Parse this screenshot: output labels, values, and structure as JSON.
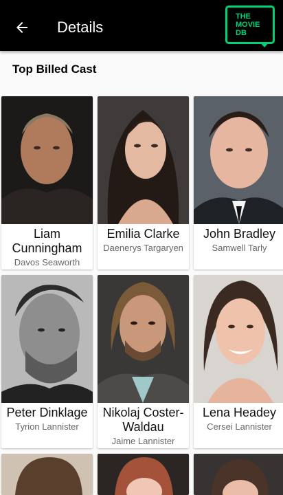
{
  "appbar": {
    "title": "Details",
    "logo_text": "THE\nMOVIE\nDB",
    "back_icon": "arrow-left-icon",
    "brand_color": "#01d277"
  },
  "section": {
    "title": "Top Billed Cast"
  },
  "cast": [
    {
      "name": "Liam Cunningham",
      "character": "Davos Seaworth"
    },
    {
      "name": "Emilia Clarke",
      "character": "Daenerys Targaryen"
    },
    {
      "name": "John Bradley",
      "character": "Samwell Tarly"
    },
    {
      "name": "Peter Dinklage",
      "character": "Tyrion Lannister"
    },
    {
      "name": "Nikolaj Coster-Waldau",
      "character": "Jaime Lannister"
    },
    {
      "name": "Lena Headey",
      "character": "Cersei Lannister"
    }
  ]
}
